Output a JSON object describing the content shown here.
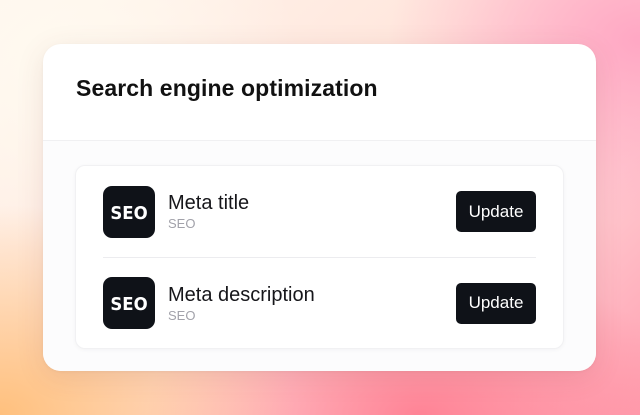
{
  "card": {
    "title": "Search engine optimization"
  },
  "items": [
    {
      "icon": "seo-icon",
      "icon_text": "SEO",
      "title": "Meta title",
      "subtitle": "SEO",
      "button_label": "Update"
    },
    {
      "icon": "seo-icon",
      "icon_text": "SEO",
      "title": "Meta description",
      "subtitle": "SEO",
      "button_label": "Update"
    }
  ],
  "colors": {
    "dark": "#0f1218",
    "muted_text": "#a2a2aa",
    "card_bg": "#ffffff"
  }
}
